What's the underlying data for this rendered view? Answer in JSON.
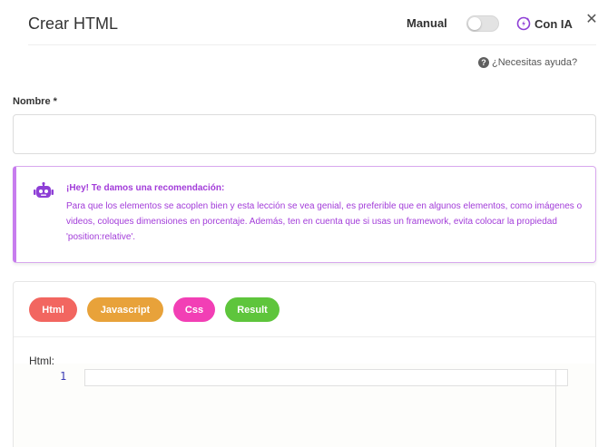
{
  "header": {
    "title": "Crear HTML",
    "manual_label": "Manual",
    "toggle_on": false,
    "ia_label": "Con IA",
    "close_symbol": "✕"
  },
  "help": {
    "text": "¿Necesitas ayuda?"
  },
  "form": {
    "name_label": "Nombre *",
    "name_value": "",
    "name_placeholder": ""
  },
  "tip": {
    "title": "¡Hey! Te damos una recomendación:",
    "body": "Para que los elementos se acoplen bien y esta lección se vea genial, es preferible que en algunos elementos, como imágenes o videos, coloques dimensiones en porcentaje. Además, ten en cuenta que si usas un framework, evita colocar la propiedad 'position:relative'."
  },
  "editor": {
    "tabs": [
      {
        "label": "Html"
      },
      {
        "label": "Javascript"
      },
      {
        "label": "Css"
      },
      {
        "label": "Result"
      }
    ],
    "code_label": "Html:",
    "line_number": "1"
  },
  "colors": {
    "tip_text": "#a23cd9",
    "tip_border": "#c77dee",
    "tab_html": "#f26660",
    "tab_js": "#e8a23a",
    "tab_css": "#f23fb5",
    "tab_result": "#5ec53c",
    "ia_icon": "#8e3fd6"
  }
}
